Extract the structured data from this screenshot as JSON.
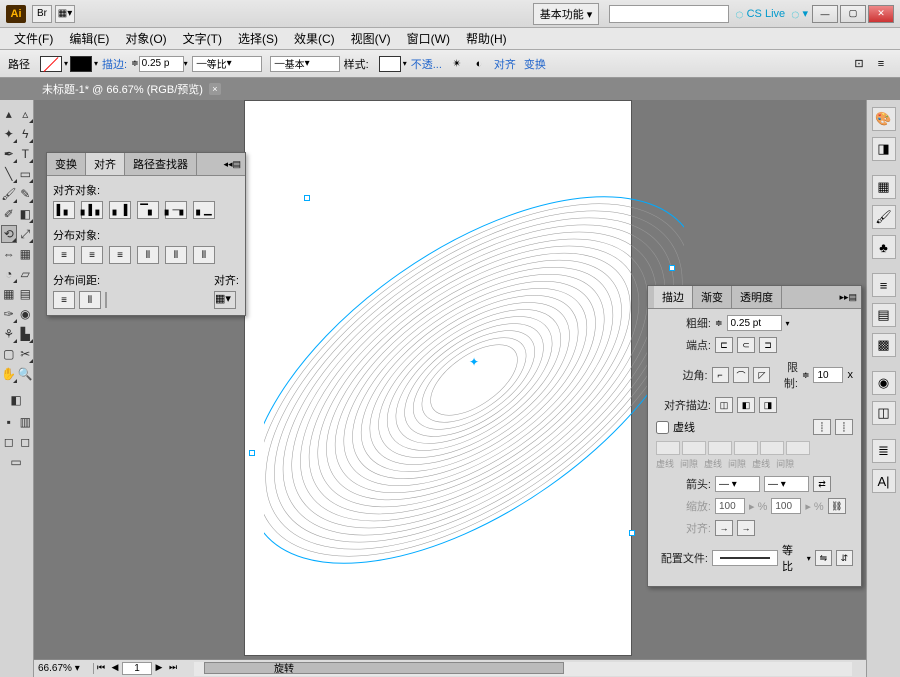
{
  "titlebar": {
    "bridge": "Br",
    "workspace": "基本功能",
    "search_placeholder": "",
    "cslive": "CS Live"
  },
  "menu": [
    "文件(F)",
    "编辑(E)",
    "对象(O)",
    "文字(T)",
    "选择(S)",
    "效果(C)",
    "视图(V)",
    "窗口(W)",
    "帮助(H)"
  ],
  "controlbar": {
    "object": "路径",
    "stroke_label": "描边:",
    "stroke_value": "0.25 p",
    "uniform": "等比",
    "basic": "基本",
    "style_label": "样式:",
    "opacity": "不透...",
    "align": "对齐",
    "transform": "变换"
  },
  "doctab": {
    "title": "未标题-1* @ 66.67% (RGB/预览)"
  },
  "align_panel": {
    "tabs": [
      "变换",
      "对齐",
      "路径查找器"
    ],
    "sec1": "对齐对象:",
    "sec2": "分布对象:",
    "sec3": "分布间距:",
    "alignto": "对齐:"
  },
  "stroke_panel": {
    "tabs": [
      "描边",
      "渐变",
      "透明度"
    ],
    "weight_label": "粗细:",
    "weight_value": "0.25 pt",
    "cap_label": "端点:",
    "corner_label": "边角:",
    "limit_label": "限制:",
    "limit_value": "10",
    "limit_unit": "x",
    "alignstroke_label": "对齐描边:",
    "dashed": "虚线",
    "dash_labels": [
      "虚线",
      "间隙",
      "虚线",
      "间隙",
      "虚线",
      "间隙"
    ],
    "arrow_label": "箭头:",
    "scale_label": "缩放:",
    "scale1": "100",
    "scale2": "100",
    "align_label": "对齐:",
    "profile_label": "配置文件:",
    "profile": "等比"
  },
  "status": {
    "zoom": "66.67%",
    "page": "1",
    "tool": "旋转"
  }
}
